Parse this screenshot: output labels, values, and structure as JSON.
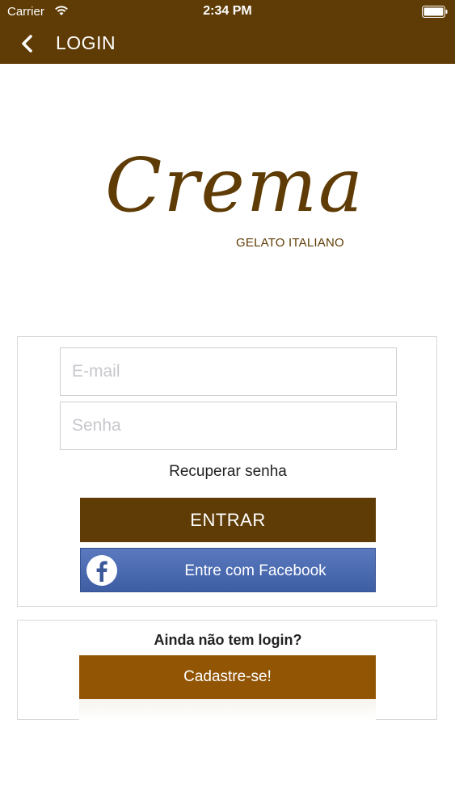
{
  "status_bar": {
    "carrier": "Carrier",
    "time": "2:34 PM"
  },
  "nav": {
    "title": "LOGIN"
  },
  "logo": {
    "script": "Crema",
    "subtitle": "GELATO ITALIANO"
  },
  "login_form": {
    "email_placeholder": "E-mail",
    "password_placeholder": "Senha",
    "recover_label": "Recuperar senha",
    "submit_label": "ENTRAR",
    "facebook_label": "Entre com Facebook"
  },
  "register": {
    "question": "Ainda não tem login?",
    "button_label": "Cadastre-se!"
  },
  "colors": {
    "brand_brown": "#5f3c05",
    "register_brown": "#925504",
    "facebook_blue": "#4a68ad"
  }
}
